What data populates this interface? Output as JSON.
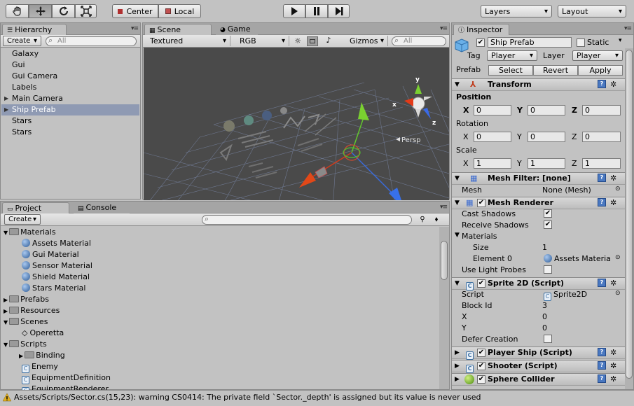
{
  "toolbar": {
    "tools": [
      "hand-icon",
      "move-icon",
      "rotate-icon",
      "scale-icon"
    ],
    "pivot": "Center",
    "space": "Local",
    "layers": "Layers",
    "layout": "Layout"
  },
  "hierarchy": {
    "tab": "Hierarchy",
    "create": "Create",
    "search_placeholder": "All",
    "items": [
      {
        "label": "Galaxy",
        "expandable": false
      },
      {
        "label": "Gui",
        "expandable": false
      },
      {
        "label": "Gui Camera",
        "expandable": false
      },
      {
        "label": "Labels",
        "expandable": false
      },
      {
        "label": "Main Camera",
        "expandable": true
      },
      {
        "label": "Ship Prefab",
        "expandable": true,
        "selected": true
      },
      {
        "label": "Stars",
        "expandable": false
      },
      {
        "label": "Stars",
        "expandable": false
      }
    ]
  },
  "scene": {
    "tab_scene": "Scene",
    "tab_game": "Game",
    "render_mode": "Textured",
    "color_mode": "RGB",
    "gizmos": "Gizmos",
    "search_placeholder": "All",
    "persp": "Persp",
    "axis_y": "y",
    "axis_x": "x",
    "axis_z": "z"
  },
  "project": {
    "tab_project": "Project",
    "tab_console": "Console",
    "create": "Create",
    "items": [
      {
        "label": "Materials",
        "type": "folder",
        "depth": 0,
        "open": true
      },
      {
        "label": "Assets Material",
        "type": "material",
        "depth": 1
      },
      {
        "label": "Gui Material",
        "type": "material",
        "depth": 1
      },
      {
        "label": "Sensor Material",
        "type": "material",
        "depth": 1
      },
      {
        "label": "Shield Material",
        "type": "material",
        "depth": 1
      },
      {
        "label": "Stars Material",
        "type": "material",
        "depth": 1
      },
      {
        "label": "Prefabs",
        "type": "folder",
        "depth": 0,
        "open": false
      },
      {
        "label": "Resources",
        "type": "folder",
        "depth": 0,
        "open": false
      },
      {
        "label": "Scenes",
        "type": "folder",
        "depth": 0,
        "open": true
      },
      {
        "label": "Operetta",
        "type": "scene",
        "depth": 1
      },
      {
        "label": "Scripts",
        "type": "folder",
        "depth": 0,
        "open": true
      },
      {
        "label": "Binding",
        "type": "folder",
        "depth": 1,
        "open": false
      },
      {
        "label": "Enemy",
        "type": "script",
        "depth": 1
      },
      {
        "label": "EquipmentDefinition",
        "type": "script",
        "depth": 1
      },
      {
        "label": "EquipmentRenderer",
        "type": "script",
        "depth": 1
      }
    ]
  },
  "inspector": {
    "tab": "Inspector",
    "object_name": "Ship Prefab",
    "static_label": "Static",
    "tag_label": "Tag",
    "tag_value": "Player",
    "layer_label": "Layer",
    "layer_value": "Player",
    "prefab_label": "Prefab",
    "select": "Select",
    "revert": "Revert",
    "apply": "Apply",
    "transform": {
      "title": "Transform",
      "position": "Position",
      "rotation": "Rotation",
      "scale": "Scale",
      "x": "X",
      "y": "Y",
      "z": "Z",
      "pos": [
        "0",
        "0",
        "0"
      ],
      "rot": [
        "0",
        "0",
        "0"
      ],
      "scl": [
        "1",
        "1",
        "1"
      ]
    },
    "mesh_filter": {
      "title": "Mesh Filter: [none]",
      "mesh_label": "Mesh",
      "mesh_value": "None (Mesh)"
    },
    "mesh_renderer": {
      "title": "Mesh Renderer",
      "cast_shadows": "Cast Shadows",
      "receive_shadows": "Receive Shadows",
      "materials": "Materials",
      "size_label": "Size",
      "size_value": "1",
      "element0_label": "Element 0",
      "element0_value": "Assets Materia",
      "use_light_probes": "Use Light Probes"
    },
    "sprite2d": {
      "title": "Sprite 2D (Script)",
      "script_label": "Script",
      "script_value": "Sprite2D",
      "block_id_label": "Block Id",
      "block_id_value": "3",
      "x_label": "X",
      "x_value": "0",
      "y_label": "Y",
      "y_value": "0",
      "defer_label": "Defer Creation"
    },
    "player_ship": "Player Ship (Script)",
    "shooter": "Shooter (Script)",
    "sphere_collider": "Sphere Collider"
  },
  "status": "Assets/Scripts/Sector.cs(15,23): warning CS0414: The private field `Sector._depth' is assigned but its value is never used"
}
